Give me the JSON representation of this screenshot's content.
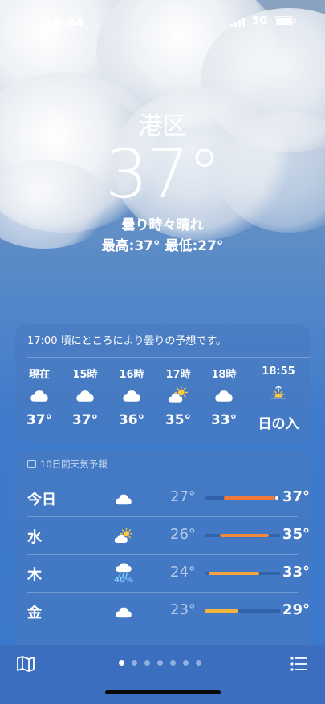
{
  "status_bar": {
    "time": "14:44",
    "network": "5G"
  },
  "location": {
    "city": "港区",
    "temperature": "37°",
    "condition": "曇り時々晴れ",
    "high_low": "最高:37°  最低:27°"
  },
  "hourly": {
    "summary": "17:00 頃にところにより曇りの予想です。",
    "items": [
      {
        "label": "現在",
        "icon": "cloud-icon",
        "temp": "37°"
      },
      {
        "label": "15時",
        "icon": "cloud-icon",
        "temp": "37°"
      },
      {
        "label": "16時",
        "icon": "cloud-icon",
        "temp": "36°"
      },
      {
        "label": "17時",
        "icon": "partly-sunny-icon",
        "temp": "35°"
      },
      {
        "label": "18時",
        "icon": "cloud-icon",
        "temp": "33°"
      },
      {
        "label": "18:55",
        "icon": "sunset-icon",
        "temp": "日の入"
      }
    ]
  },
  "daily": {
    "title": "10日間天気予報",
    "items": [
      {
        "day": "今日",
        "icon": "cloud-icon",
        "pop": "",
        "low": "27°",
        "high": "37°",
        "range_start": 0.26,
        "range_end": 0.96,
        "current": 0.96,
        "color": "#f07a3a"
      },
      {
        "day": "水",
        "icon": "partly-sunny-icon",
        "pop": "",
        "low": "26°",
        "high": "35°",
        "range_start": 0.2,
        "range_end": 0.85,
        "current": null,
        "color": "#f08a3e"
      },
      {
        "day": "木",
        "icon": "rain-icon",
        "pop": "40%",
        "low": "24°",
        "high": "33°",
        "range_start": 0.05,
        "range_end": 0.72,
        "current": null,
        "color": "#f5a33c"
      },
      {
        "day": "金",
        "icon": "cloud-icon",
        "pop": "",
        "low": "23°",
        "high": "29°",
        "range_start": 0.0,
        "range_end": 0.45,
        "current": null,
        "color": "#f2b43a"
      }
    ]
  },
  "pager": {
    "count": 7,
    "active": 0
  },
  "colors": {
    "rain": "#7fd3ff",
    "sun": "#ffc93a"
  }
}
